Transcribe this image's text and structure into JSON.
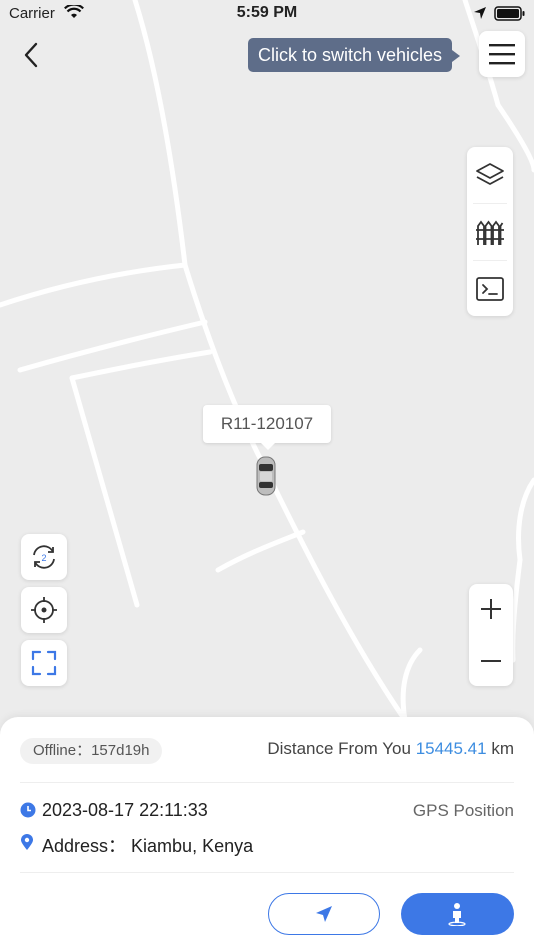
{
  "status_bar": {
    "carrier": "Carrier",
    "time": "5:59 PM"
  },
  "header": {
    "switch_tooltip": "Click to switch vehicles"
  },
  "map": {
    "vehicle_plate": "R11-120107",
    "left_controls": [
      "replay-icon",
      "locate-icon",
      "fit-view-icon"
    ],
    "right_tools": [
      "layers-icon",
      "geofence-icon",
      "command-icon"
    ],
    "zoom": [
      "zoom-in-icon",
      "zoom-out-icon"
    ]
  },
  "info": {
    "offline_label": "Offline：157d19h",
    "distance_prefix": "Distance From You",
    "distance_value": "15445.41",
    "distance_unit": "km",
    "timestamp": "2023-08-17 22:11:33",
    "position_type": "GPS Position",
    "address": "Address： Kiambu, Kenya"
  },
  "actions": {
    "navigate_icon": "navigate-icon",
    "street_view_icon": "street-view-icon"
  },
  "colors": {
    "accent": "#3d78e6",
    "link": "#3d8de0",
    "tooltip_bg": "#5e6d89",
    "map_bg": "#ececec"
  }
}
